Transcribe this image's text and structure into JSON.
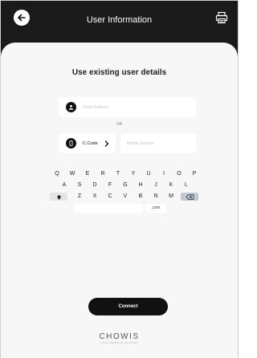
{
  "header": {
    "title": "User Information",
    "back_icon": "arrow-left-icon",
    "print_icon": "printer-icon"
  },
  "main": {
    "heading": "Use existing user details",
    "email": {
      "placeholder": "Email Address",
      "icon": "user-icon"
    },
    "or_label": "OR",
    "country_code": {
      "label": "C.Code",
      "icon": "phone-icon",
      "chevron": "chevron-right-icon"
    },
    "mobile": {
      "placeholder": "Mobile Number"
    }
  },
  "keyboard": {
    "row1": [
      "Q",
      "W",
      "E",
      "R",
      "T",
      "Y",
      "U",
      "I",
      "O",
      "P"
    ],
    "row2": [
      "A",
      "S",
      "D",
      "F",
      "G",
      "H",
      "J",
      "K",
      "L"
    ],
    "row3": [
      "Z",
      "X",
      "C",
      "V",
      "B",
      "N",
      "M"
    ],
    "com_key": ".com",
    "shift_icon": "shift-icon",
    "backspace_icon": "backspace-icon"
  },
  "connect_label": "Connect",
  "brand": {
    "name": "CHOWIS",
    "tagline": "YOUR CHOICE OF SOLUTION"
  }
}
